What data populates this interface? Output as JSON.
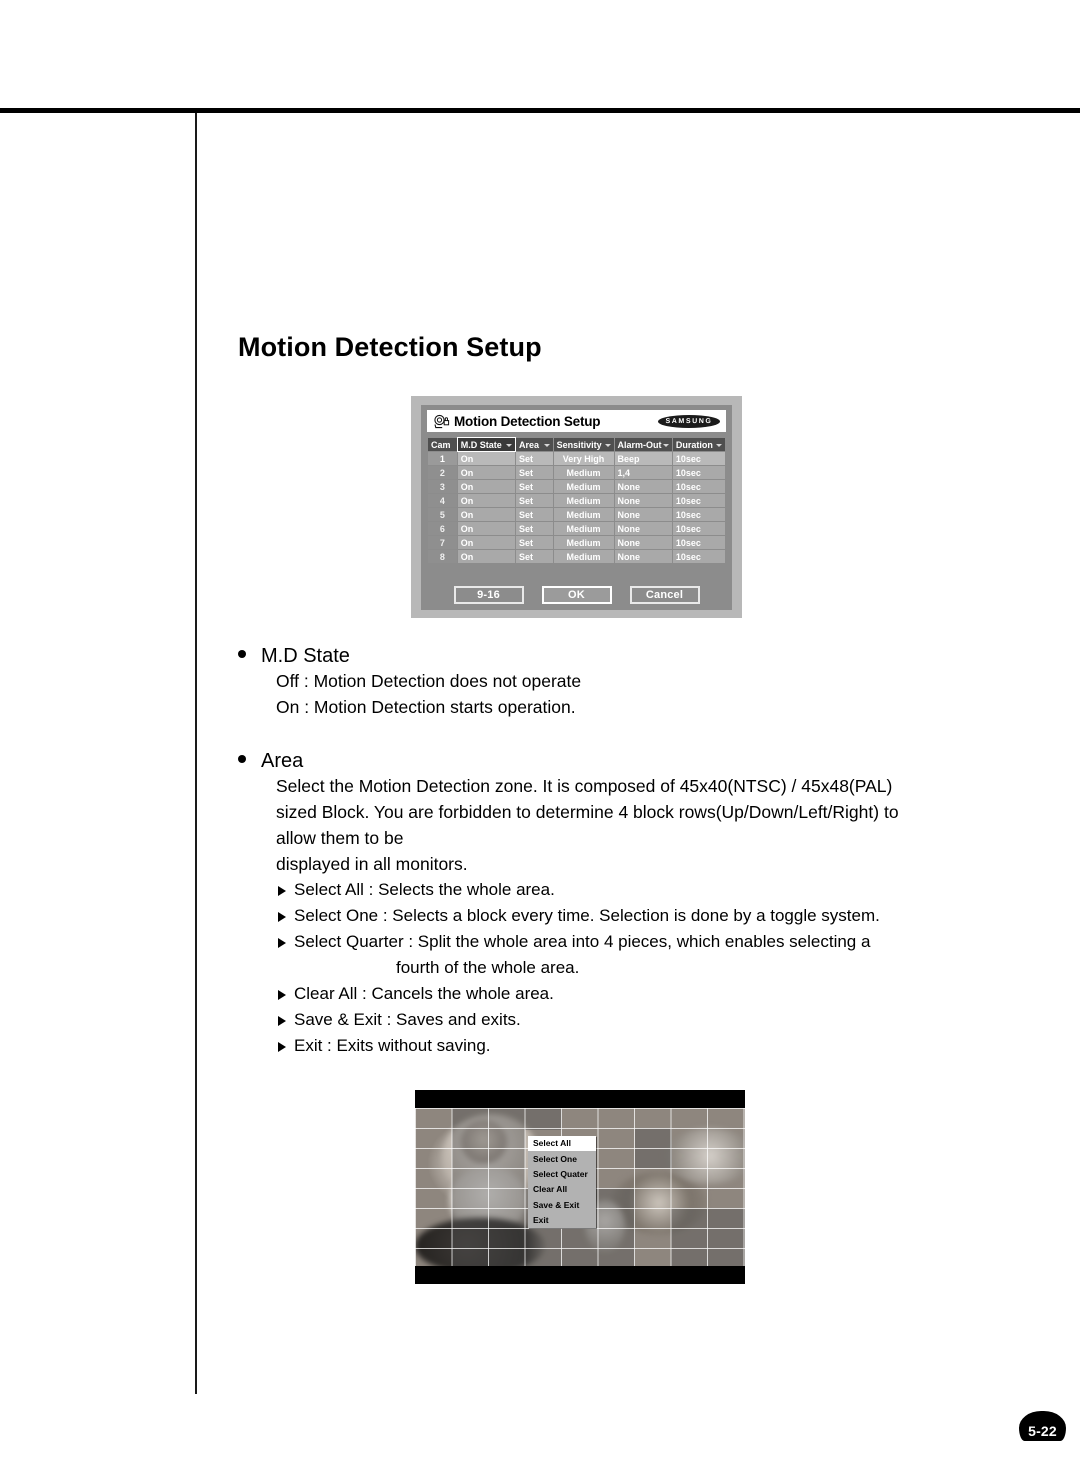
{
  "page": {
    "heading": "Motion Detection Setup",
    "page_number": "5-22"
  },
  "dialog": {
    "icon": "camera-lock-icon",
    "title": "Motion Detection Setup",
    "brand": "SAMSUNG",
    "columns": [
      "Cam",
      "M.D State",
      "Area",
      "Sensitivity",
      "Alarm-Out",
      "Duration"
    ],
    "selected_column": "M.D State",
    "rows": [
      {
        "cam": "1",
        "md_state": "On",
        "area": "Set",
        "sensitivity": "Very High",
        "alarm_out": "Beep",
        "duration": "10sec"
      },
      {
        "cam": "2",
        "md_state": "On",
        "area": "Set",
        "sensitivity": "Medium",
        "alarm_out": "1,4",
        "duration": "10sec"
      },
      {
        "cam": "3",
        "md_state": "On",
        "area": "Set",
        "sensitivity": "Medium",
        "alarm_out": "None",
        "duration": "10sec"
      },
      {
        "cam": "4",
        "md_state": "On",
        "area": "Set",
        "sensitivity": "Medium",
        "alarm_out": "None",
        "duration": "10sec"
      },
      {
        "cam": "5",
        "md_state": "On",
        "area": "Set",
        "sensitivity": "Medium",
        "alarm_out": "None",
        "duration": "10sec"
      },
      {
        "cam": "6",
        "md_state": "On",
        "area": "Set",
        "sensitivity": "Medium",
        "alarm_out": "None",
        "duration": "10sec"
      },
      {
        "cam": "7",
        "md_state": "On",
        "area": "Set",
        "sensitivity": "Medium",
        "alarm_out": "None",
        "duration": "10sec"
      },
      {
        "cam": "8",
        "md_state": "On",
        "area": "Set",
        "sensitivity": "Medium",
        "alarm_out": "None",
        "duration": "10sec"
      }
    ],
    "buttons": {
      "page_range": "9-16",
      "ok": "OK",
      "cancel": "Cancel"
    }
  },
  "content": {
    "md_state": {
      "title": "M.D State",
      "line_off": "Off : Motion Detection does not operate",
      "line_on": "On : Motion Detection starts operation."
    },
    "area": {
      "title": "Area",
      "p1": "Select the Motion Detection zone. It is composed of 45x40(NTSC) / 45x48(PAL)",
      "p2": "sized Block. You are forbidden to determine 4 block rows(Up/Down/Left/Right) to",
      "p3": "allow them to be",
      "p4": "displayed in all monitors.",
      "items": [
        "Select All : Selects the whole area.",
        "Select One : Selects a block every time. Selection is done by a toggle system.",
        "Select Quarter : Split the whole area into 4 pieces, which enables selecting a",
        "Clear All : Cancels the whole area.",
        "Save & Exit : Saves and exits.",
        "Exit : Exits without saving."
      ],
      "item_continuation": "fourth of the whole area."
    }
  },
  "photo": {
    "menu_items": [
      "Select All",
      "Select One",
      "Select Quater",
      "Clear All",
      "Save & Exit",
      "Exit"
    ],
    "active_menu_item": "Select All"
  }
}
